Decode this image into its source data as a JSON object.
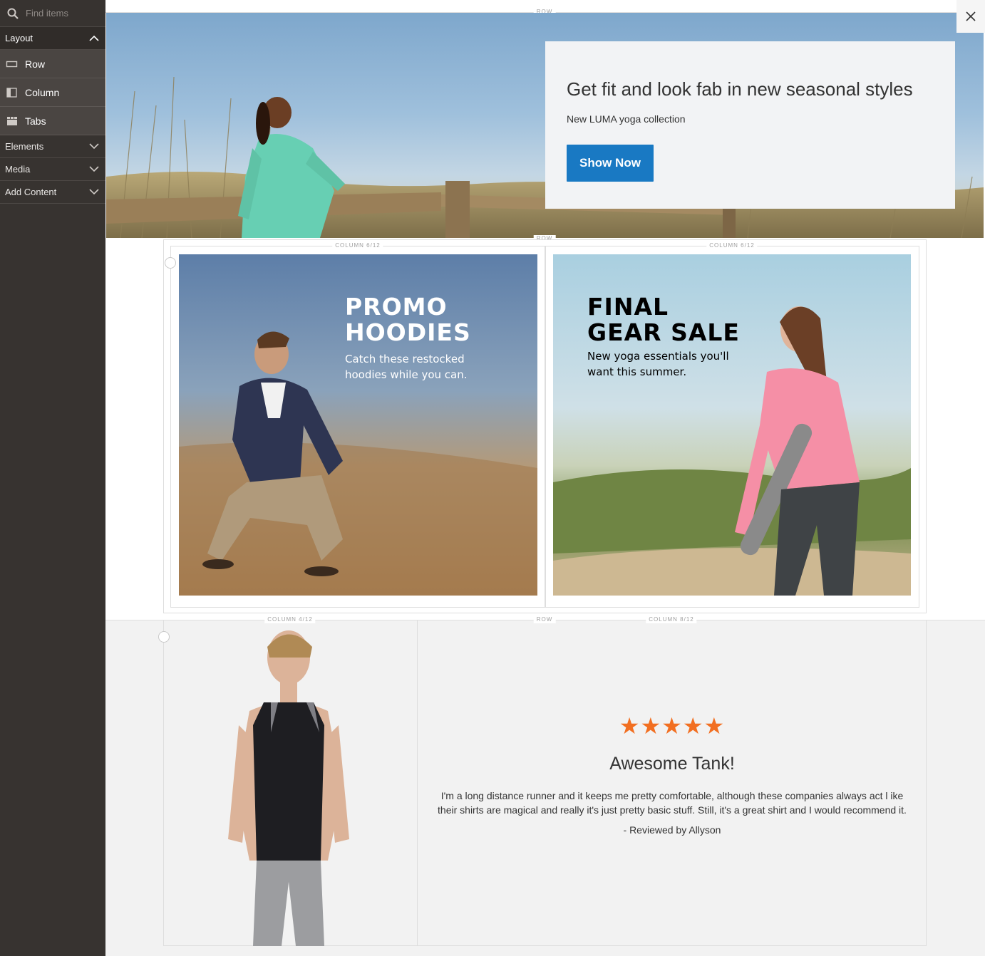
{
  "sidebar": {
    "search_placeholder": "Find items",
    "groups": [
      {
        "label": "Layout",
        "open": true
      },
      {
        "label": "Elements"
      },
      {
        "label": "Media"
      },
      {
        "label": "Add Content"
      }
    ],
    "layout_items": [
      {
        "label": "Row",
        "icon": "row-icon"
      },
      {
        "label": "Column",
        "icon": "column-icon"
      },
      {
        "label": "Tabs",
        "icon": "tabs-icon"
      }
    ]
  },
  "stage": {
    "row_label": "ROW",
    "hero": {
      "title": "Get fit and look fab in new seasonal styles",
      "subtitle": "New LUMA yoga collection",
      "button": "Show Now"
    },
    "columns_row": {
      "left_label": "COLUMN 6/12",
      "right_label": "COLUMN 6/12",
      "promo_left": {
        "title_line1": "PROMO",
        "title_line2": "HOODIES",
        "text_line1": "Catch these restocked",
        "text_line2": "hoodies while you can."
      },
      "promo_right": {
        "title_line1": "FINAL",
        "title_line2": "GEAR SALE",
        "text_line1": "New yoga essentials you'll",
        "text_line2": "want this summer."
      }
    },
    "bottom_row": {
      "left_label": "COLUMN 4/12",
      "right_label": "COLUMN 8/12",
      "review": {
        "stars": "★★★★★",
        "rating": 5,
        "title": "Awesome Tank!",
        "body_line1": "I'm a long distance runner and it keeps me pretty comfortable, although these companies always act l ike",
        "body_line2": "their shirts are magical and really it's just pretty basic stuff.  Still, it's a great shirt and I would recommend it.",
        "byline": "- Reviewed by Allyson"
      }
    }
  },
  "colors": {
    "sidebar_bg": "#373330",
    "button_blue": "#1979c3",
    "star_orange": "#f26f21"
  }
}
